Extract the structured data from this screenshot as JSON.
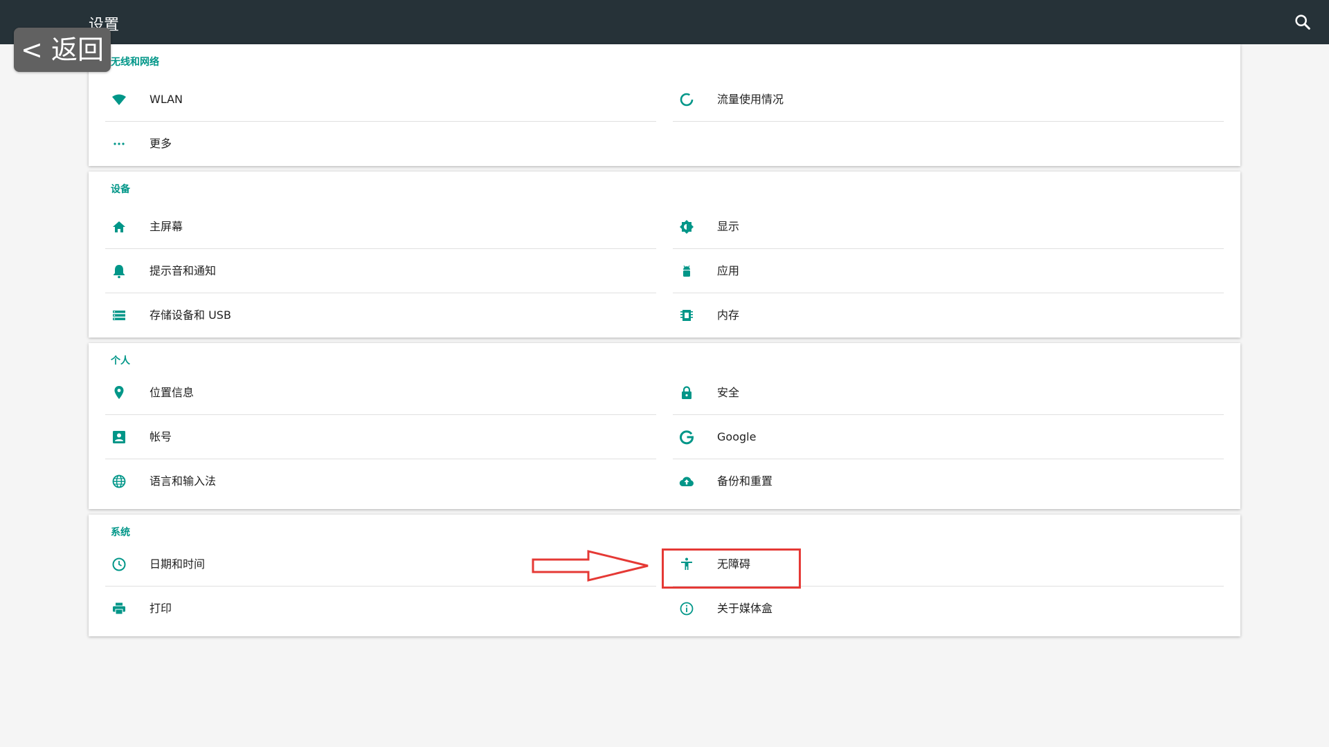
{
  "app": {
    "title": "设置"
  },
  "back_button": {
    "label": "< 返回"
  },
  "colors": {
    "accent": "#009688",
    "topbar": "#263238",
    "highlight": "#e53935"
  },
  "sections": [
    {
      "header": "无线和网络",
      "items": [
        {
          "label": "WLAN",
          "icon": "wifi-icon"
        },
        {
          "label": "流量使用情况",
          "icon": "data-usage-icon"
        },
        {
          "label": "更多",
          "icon": "more-dots-icon"
        }
      ]
    },
    {
      "header": "设备",
      "items": [
        {
          "label": "主屏幕",
          "icon": "home-icon"
        },
        {
          "label": "显示",
          "icon": "brightness-icon"
        },
        {
          "label": "提示音和通知",
          "icon": "bell-icon"
        },
        {
          "label": "应用",
          "icon": "android-icon"
        },
        {
          "label": "存储设备和 USB",
          "icon": "storage-icon"
        },
        {
          "label": "内存",
          "icon": "memory-icon"
        }
      ]
    },
    {
      "header": "个人",
      "items": [
        {
          "label": "位置信息",
          "icon": "location-icon"
        },
        {
          "label": "安全",
          "icon": "lock-icon"
        },
        {
          "label": "帐号",
          "icon": "account-icon"
        },
        {
          "label": "Google",
          "icon": "google-icon"
        },
        {
          "label": "语言和输入法",
          "icon": "globe-icon"
        },
        {
          "label": "备份和重置",
          "icon": "cloud-upload-icon"
        }
      ]
    },
    {
      "header": "系统",
      "items": [
        {
          "label": "日期和时间",
          "icon": "clock-icon"
        },
        {
          "label": "无障碍",
          "icon": "accessibility-icon"
        },
        {
          "label": "打印",
          "icon": "print-icon"
        },
        {
          "label": "关于媒体盒",
          "icon": "info-icon"
        }
      ]
    }
  ],
  "annotation": {
    "highlighted_item": "无障碍"
  }
}
